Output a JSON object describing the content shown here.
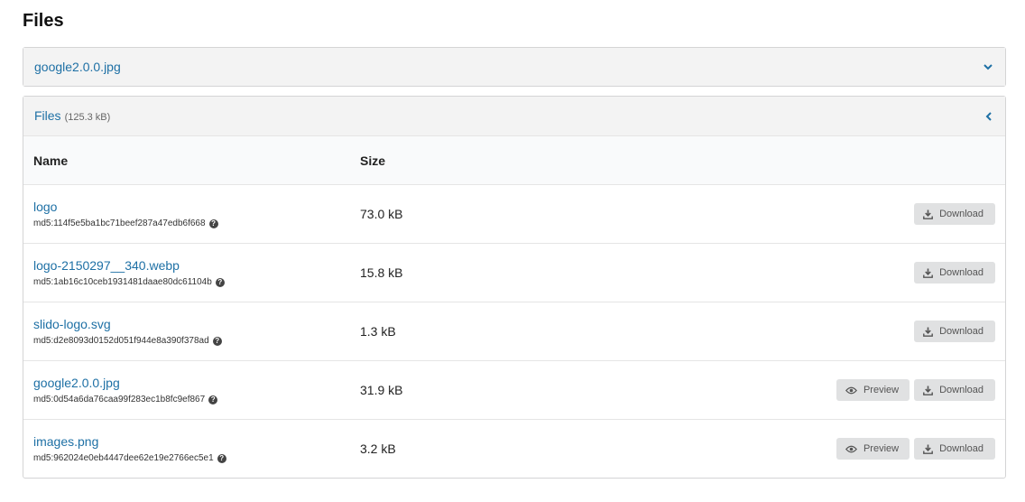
{
  "page": {
    "title": "Files"
  },
  "accordion_top": {
    "title": "google2.0.0.jpg"
  },
  "files_panel": {
    "title": "Files",
    "total_size": "(125.3 kB)",
    "columns": {
      "name": "Name",
      "size": "Size"
    },
    "rows": [
      {
        "name": "logo",
        "md5": "md5:114f5e5ba1bc71beef287a47edb6f668",
        "size": "73.0 kB",
        "preview": "",
        "download": "Download"
      },
      {
        "name": "logo-2150297__340.webp",
        "md5": "md5:1ab16c10ceb1931481daae80dc61104b",
        "size": "15.8 kB",
        "preview": "",
        "download": "Download"
      },
      {
        "name": "slido-logo.svg",
        "md5": "md5:d2e8093d0152d051f944e8a390f378ad",
        "size": "1.3 kB",
        "preview": "",
        "download": "Download"
      },
      {
        "name": "google2.0.0.jpg",
        "md5": "md5:0d54a6da76caa99f283ec1b8fc9ef867",
        "size": "31.9 kB",
        "preview": "Preview",
        "download": "Download"
      },
      {
        "name": "images.png",
        "md5": "md5:962024e0eb4447dee62e19e2766ec5e1",
        "size": "3.2 kB",
        "preview": "Preview",
        "download": "Download"
      }
    ]
  },
  "colors": {
    "link": "#1e70a5",
    "header_bg": "#f3f3f3",
    "button_bg": "#e0e1e2"
  },
  "icons": {
    "expand": "chevron-down-icon",
    "collapse": "chevron-left-icon",
    "download": "download-icon",
    "preview": "eye-icon",
    "help": "question-circle-icon"
  }
}
